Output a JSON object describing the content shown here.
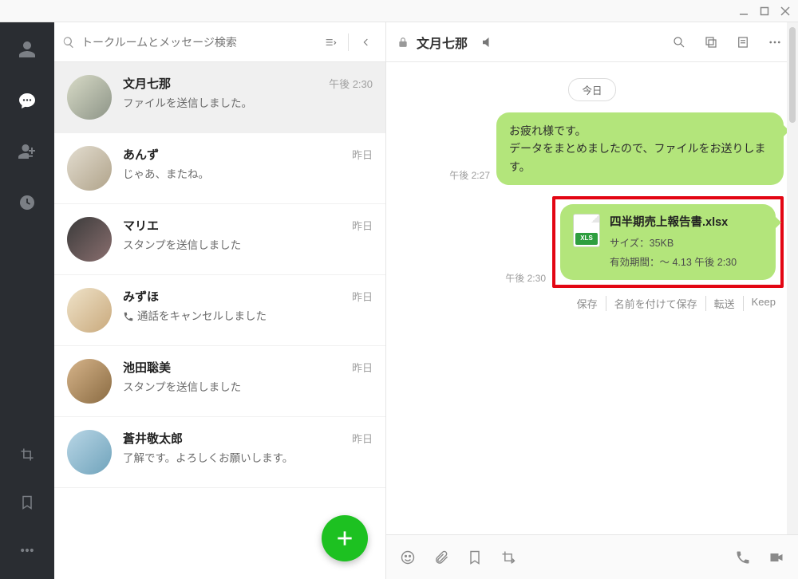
{
  "window": {
    "minimize": "—",
    "maximize": "☐",
    "close": "✕"
  },
  "search": {
    "placeholder": "トークルームとメッセージ検索"
  },
  "chats": [
    {
      "name": "文月七那",
      "preview": "ファイルを送信しました。",
      "time": "午後 2:30",
      "selected": true,
      "icon": null
    },
    {
      "name": "あんず",
      "preview": "じゃあ、またね。",
      "time": "昨日",
      "icon": null
    },
    {
      "name": "マリエ",
      "preview": "スタンプを送信しました",
      "time": "昨日",
      "icon": null
    },
    {
      "name": "みずほ",
      "preview": "通話をキャンセルしました",
      "time": "昨日",
      "icon": "phone"
    },
    {
      "name": "池田聡美",
      "preview": "スタンプを送信しました",
      "time": "昨日",
      "icon": null
    },
    {
      "name": "蒼井敬太郎",
      "preview": "了解です。よろしくお願いします。",
      "time": "昨日",
      "icon": null
    }
  ],
  "conversation": {
    "title": "文月七那",
    "date_label": "今日",
    "messages": [
      {
        "time": "午後 2:27",
        "text": "お疲れ様です。\nデータをまとめましたので、ファイルをお送りします。"
      },
      {
        "time": "午後 2:30",
        "file": {
          "name": "四半期売上報告書.xlsx",
          "size_label": "サイズ：35KB",
          "expiry_label": "有効期間：～ 4.13 午後 2:30",
          "tag": "XLS"
        }
      }
    ],
    "actions": {
      "save": "保存",
      "save_as": "名前を付けて保存",
      "forward": "転送",
      "keep": "Keep"
    }
  }
}
